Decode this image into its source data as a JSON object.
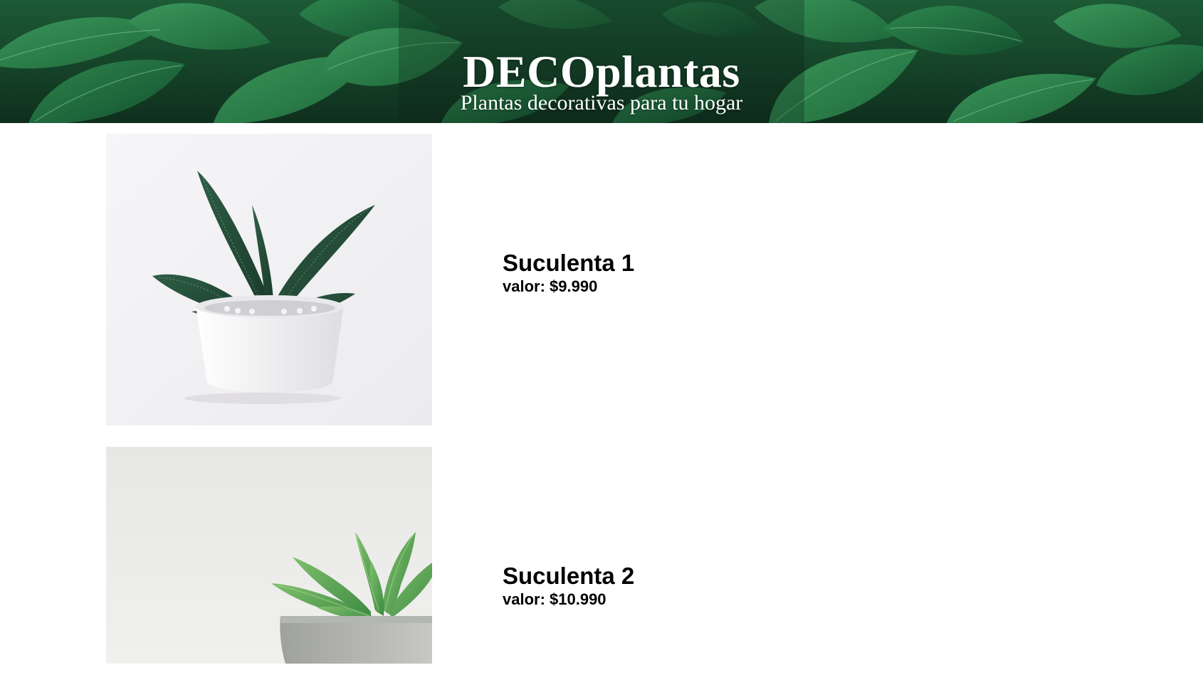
{
  "header": {
    "title": "DECOplantas",
    "subtitle": "Plantas decorativas para tu hogar",
    "background_icon": "leaves-banner"
  },
  "products": [
    {
      "name": "Suculenta 1",
      "price_label": "valor: $9.990",
      "image_icon": "succulent-white-pot"
    },
    {
      "name": "Suculenta 2",
      "price_label": "valor: $10.990",
      "image_icon": "succulent-gray-pot"
    }
  ],
  "colors": {
    "hero_dark": "#16432a",
    "leaf_green": "#2f8a4f",
    "text": "#000000",
    "hero_text": "#ffffff"
  }
}
